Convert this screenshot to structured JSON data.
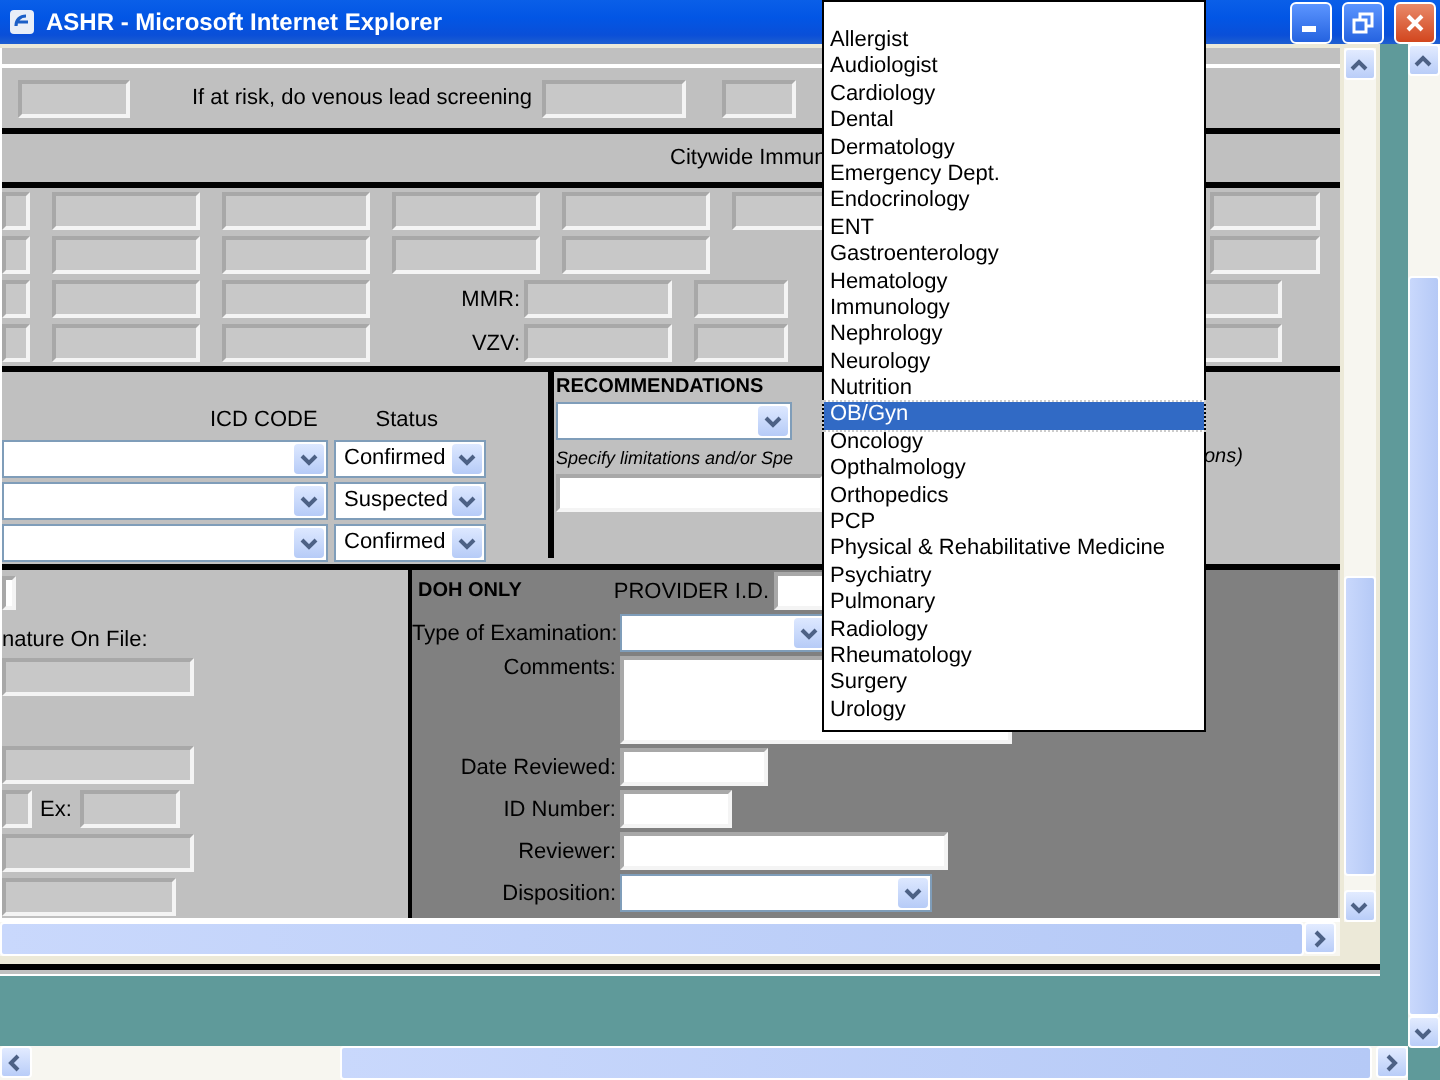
{
  "window": {
    "title": "ASHR - Microsoft Internet Explorer"
  },
  "screening": {
    "label": "If at risk, do venous lead screening"
  },
  "immunization": {
    "heading": "Citywide Immun",
    "rows": [
      {
        "kind": "full"
      },
      {
        "kind": "partial"
      },
      {
        "kind": "labeled",
        "label": "MMR:"
      },
      {
        "kind": "labeled",
        "label": "VZV:"
      }
    ]
  },
  "diagnosis": {
    "code_header": "ICD CODE",
    "status_header": "Status",
    "rows": [
      {
        "status": "Confirmed"
      },
      {
        "status": "Suspected"
      },
      {
        "status": "Confirmed"
      }
    ]
  },
  "recommendations": {
    "heading": "RECOMMENDATIONS",
    "note": "Specify limitations and/or Spe",
    "note_end": "ons)"
  },
  "signature": {
    "label": "nature On File:",
    "extension_label": "Ex:"
  },
  "doh": {
    "heading": "DOH ONLY",
    "provider_label": "PROVIDER I.D.",
    "fields": [
      {
        "label": "Type of Examination:",
        "kind": "select"
      },
      {
        "label": "Comments:",
        "kind": "textarea"
      },
      {
        "label": "Date Reviewed:",
        "kind": "date"
      },
      {
        "label": "ID Number:",
        "kind": "number"
      },
      {
        "label": "Reviewer:",
        "kind": "text"
      },
      {
        "label": "Disposition:",
        "kind": "select"
      }
    ]
  },
  "dropdown": {
    "items": [
      {
        "label": "Allergist",
        "selected": false
      },
      {
        "label": "Audiologist",
        "selected": false
      },
      {
        "label": "Cardiology",
        "selected": false
      },
      {
        "label": "Dental",
        "selected": false
      },
      {
        "label": "Dermatology",
        "selected": false
      },
      {
        "label": "Emergency Dept.",
        "selected": false
      },
      {
        "label": "Endocrinology",
        "selected": false
      },
      {
        "label": "ENT",
        "selected": false
      },
      {
        "label": "Gastroenterology",
        "selected": false
      },
      {
        "label": "Hematology",
        "selected": false
      },
      {
        "label": "Immunology",
        "selected": false
      },
      {
        "label": "Nephrology",
        "selected": false
      },
      {
        "label": "Neurology",
        "selected": false
      },
      {
        "label": "Nutrition",
        "selected": false
      },
      {
        "label": "OB/Gyn",
        "selected": true
      },
      {
        "label": "Oncology",
        "selected": false
      },
      {
        "label": "Opthalmology",
        "selected": false
      },
      {
        "label": "Orthopedics",
        "selected": false
      },
      {
        "label": "PCP",
        "selected": false
      },
      {
        "label": "Physical & Rehabilitative Medicine",
        "selected": false
      },
      {
        "label": "Psychiatry",
        "selected": false
      },
      {
        "label": "Pulmonary",
        "selected": false
      },
      {
        "label": "Radiology",
        "selected": false
      },
      {
        "label": "Rheumatology",
        "selected": false
      },
      {
        "label": "Surgery",
        "selected": false
      },
      {
        "label": "Urology",
        "selected": false
      }
    ]
  }
}
